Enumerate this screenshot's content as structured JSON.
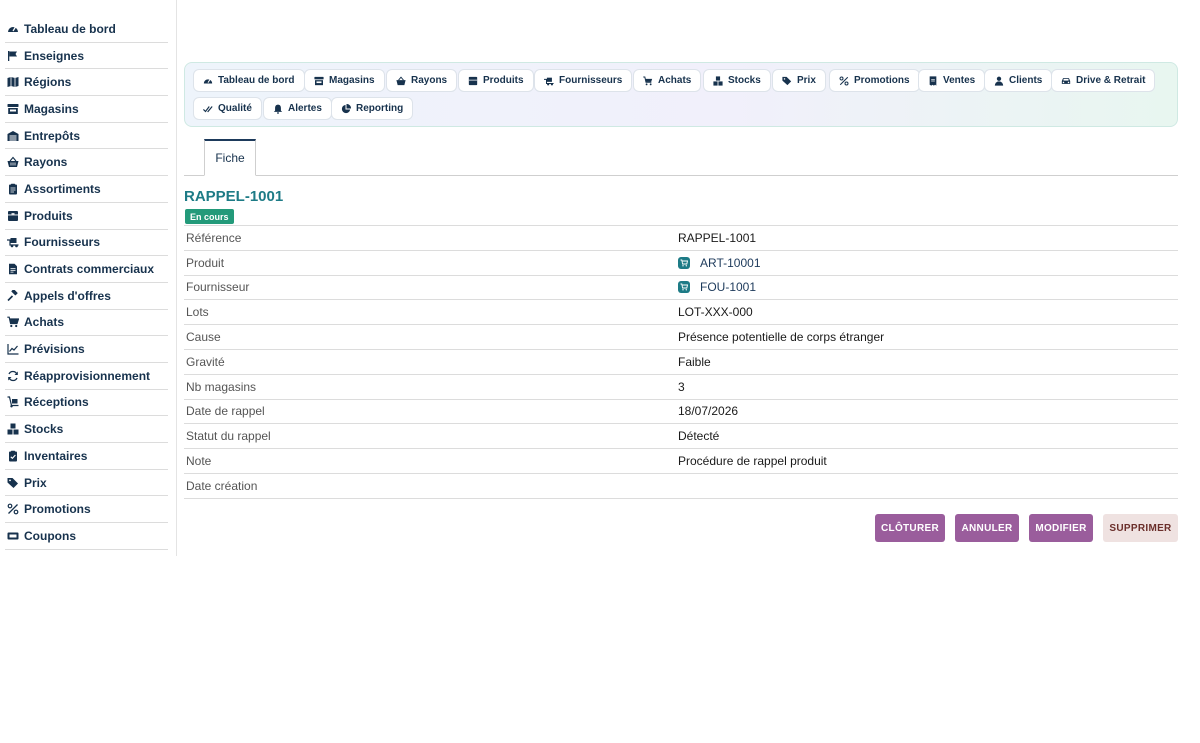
{
  "sidebar": {
    "items": [
      {
        "label": "Tableau de bord",
        "icon": "gauge-icon"
      },
      {
        "label": "Enseignes",
        "icon": "flag-icon"
      },
      {
        "label": "Régions",
        "icon": "map-icon"
      },
      {
        "label": "Magasins",
        "icon": "store-icon"
      },
      {
        "label": "Entrepôts",
        "icon": "warehouse-icon"
      },
      {
        "label": "Rayons",
        "icon": "basket-icon"
      },
      {
        "label": "Assortiments",
        "icon": "clipboard-icon"
      },
      {
        "label": "Produits",
        "icon": "box-icon"
      },
      {
        "label": "Fournisseurs",
        "icon": "truck-icon"
      },
      {
        "label": "Contrats commerciaux",
        "icon": "contract-icon"
      },
      {
        "label": "Appels d'offres",
        "icon": "gavel-icon"
      },
      {
        "label": "Achats",
        "icon": "cart-icon"
      },
      {
        "label": "Prévisions",
        "icon": "chart-line-icon"
      },
      {
        "label": "Réapprovisionnement",
        "icon": "refresh-icon"
      },
      {
        "label": "Réceptions",
        "icon": "dolly-icon"
      },
      {
        "label": "Stocks",
        "icon": "boxes-icon"
      },
      {
        "label": "Inventaires",
        "icon": "clipboard-check-icon"
      },
      {
        "label": "Prix",
        "icon": "tags-icon"
      },
      {
        "label": "Promotions",
        "icon": "percent-icon"
      },
      {
        "label": "Coupons",
        "icon": "ticket-icon"
      }
    ]
  },
  "nav": {
    "items": [
      {
        "label": "Tableau de bord",
        "icon": "gauge-icon"
      },
      {
        "label": "Magasins",
        "icon": "store-icon"
      },
      {
        "label": "Rayons",
        "icon": "basket-icon"
      },
      {
        "label": "Produits",
        "icon": "box-icon"
      },
      {
        "label": "Fournisseurs",
        "icon": "truck-icon"
      },
      {
        "label": "Achats",
        "icon": "cart-icon"
      },
      {
        "label": "Stocks",
        "icon": "boxes-icon"
      },
      {
        "label": "Prix",
        "icon": "tags-icon"
      },
      {
        "label": "Promotions",
        "icon": "percent-icon"
      },
      {
        "label": "Ventes",
        "icon": "receipt-icon"
      },
      {
        "label": "Clients",
        "icon": "user-icon"
      },
      {
        "label": "Drive & Retrait",
        "icon": "car-icon"
      },
      {
        "label": "Qualité",
        "icon": "check-double-icon"
      },
      {
        "label": "Alertes",
        "icon": "bell-icon"
      },
      {
        "label": "Reporting",
        "icon": "pie-chart-icon"
      }
    ]
  },
  "tabs": [
    {
      "label": "Fiche"
    }
  ],
  "record": {
    "title": "RAPPEL-1001",
    "status": "En cours",
    "fields": [
      {
        "label": "Référence",
        "value": "RAPPEL-1001",
        "link": false
      },
      {
        "label": "Produit",
        "value": "ART-10001",
        "link": true
      },
      {
        "label": "Fournisseur",
        "value": "FOU-1001",
        "link": true
      },
      {
        "label": "Lots",
        "value": "LOT-XXX-000",
        "link": false
      },
      {
        "label": "Cause",
        "value": "Présence potentielle de corps étranger",
        "link": false
      },
      {
        "label": "Gravité",
        "value": "Faible",
        "link": false
      },
      {
        "label": "Nb magasins",
        "value": "3",
        "link": false
      },
      {
        "label": "Date de rappel",
        "value": "18/07/2026",
        "link": false
      },
      {
        "label": "Statut du rappel",
        "value": "Détecté",
        "link": false
      },
      {
        "label": "Note",
        "value": "Procédure de rappel produit",
        "link": false
      },
      {
        "label": "Date création",
        "value": "",
        "link": false
      }
    ]
  },
  "actions": {
    "close": "CLÔTURER",
    "cancel": "ANNULER",
    "edit": "MODIFIER",
    "delete": "SUPPRIMER"
  },
  "colors": {
    "accent": "#9a5d9c",
    "title": "#1d7b86",
    "status": "#239a7a",
    "navy": "#17324d"
  }
}
